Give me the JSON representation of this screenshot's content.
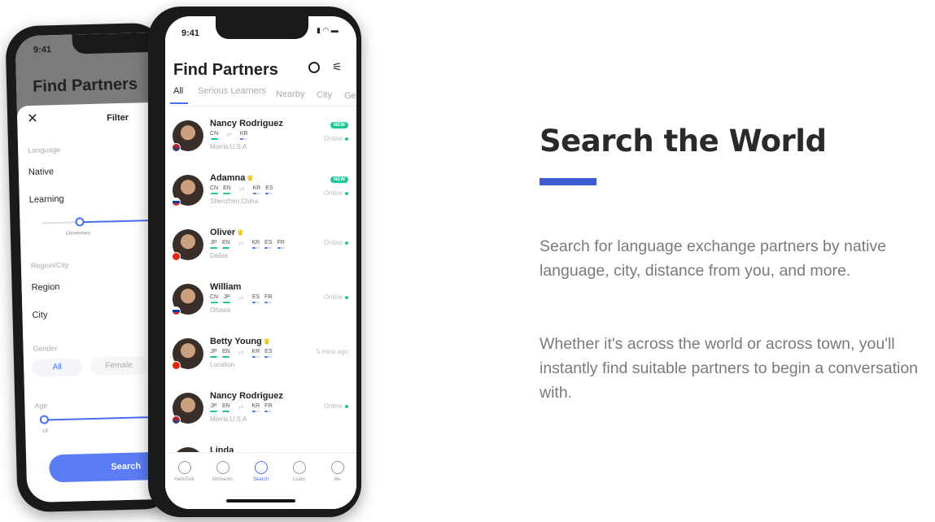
{
  "back_phone": {
    "time": "9:41",
    "title": "Find Partners",
    "filter": {
      "close_icon": "x-icon",
      "title": "Filter",
      "language_label": "Language",
      "native": "Native",
      "learning": "Learning",
      "level": "Elementary",
      "region_label": "Region/City",
      "region": "Region",
      "city": "City",
      "gender_label": "Gender",
      "gender_options": [
        "All",
        "Female"
      ],
      "age_label": "Age",
      "age_min": "18",
      "search_button": "Search"
    }
  },
  "front_phone": {
    "time": "9:41",
    "title": "Find Partners",
    "tabs": [
      "All",
      "Serious Learners",
      "Nearby",
      "City",
      "Ge"
    ],
    "partners": [
      {
        "name": "Nancy Rodriguez",
        "crown": false,
        "native": [
          "CN"
        ],
        "learning": [
          "KR"
        ],
        "location": "Morris,U.S.A",
        "badge": "NEW",
        "status": "Online",
        "online": true,
        "flag": "us"
      },
      {
        "name": "Adamna",
        "crown": true,
        "native": [
          "CN",
          "EN"
        ],
        "learning": [
          "KR",
          "ES"
        ],
        "location": "Shenzhen,China",
        "badge": "NEW",
        "status": "Online",
        "online": true,
        "flag": "ru"
      },
      {
        "name": "Oliver",
        "crown": true,
        "native": [
          "JP",
          "EN"
        ],
        "learning": [
          "KR",
          "ES",
          "FR"
        ],
        "location": "Dallas",
        "badge": "",
        "status": "Online",
        "online": true,
        "flag": "cn"
      },
      {
        "name": "William",
        "crown": false,
        "native": [
          "CN",
          "JP"
        ],
        "learning": [
          "ES",
          "FR"
        ],
        "location": "Ottawa",
        "badge": "",
        "status": "Online",
        "online": true,
        "flag": "ru"
      },
      {
        "name": "Betty Young",
        "crown": true,
        "native": [
          "JP",
          "EN"
        ],
        "learning": [
          "KR",
          "ES"
        ],
        "location": "Location",
        "badge": "",
        "status": "5 mins ago",
        "online": false,
        "flag": "cn"
      },
      {
        "name": "Nancy Rodriguez",
        "crown": false,
        "native": [
          "JP",
          "EN"
        ],
        "learning": [
          "KR",
          "FR"
        ],
        "location": "Morris,U.S.A",
        "badge": "",
        "status": "Online",
        "online": true,
        "flag": "us"
      },
      {
        "name": "Linda",
        "crown": false,
        "native": [],
        "learning": [],
        "location": "",
        "badge": "",
        "status": "",
        "online": false,
        "flag": ""
      }
    ],
    "nav": [
      {
        "label": "HelloTalk",
        "icon": "chat-bubble-icon"
      },
      {
        "label": "Moments",
        "icon": "planet-icon"
      },
      {
        "label": "Search",
        "icon": "search-icon",
        "active": true
      },
      {
        "label": "Learn",
        "icon": "book-icon"
      },
      {
        "label": "Me",
        "icon": "person-icon"
      }
    ]
  },
  "content": {
    "heading": "Search the World",
    "paragraph1": "Search for language exchange partners by native language, city, distance from you, and more.",
    "paragraph2": "Whether it's across the world or across town, you'll instantly find suitable partners to begin a conversation with."
  },
  "colors": {
    "accent": "#3f5bd0",
    "app_blue": "#4a6cf7",
    "online_green": "#1fc69a",
    "heading": "#2a2a2a",
    "body_text": "#7a7a7a"
  }
}
